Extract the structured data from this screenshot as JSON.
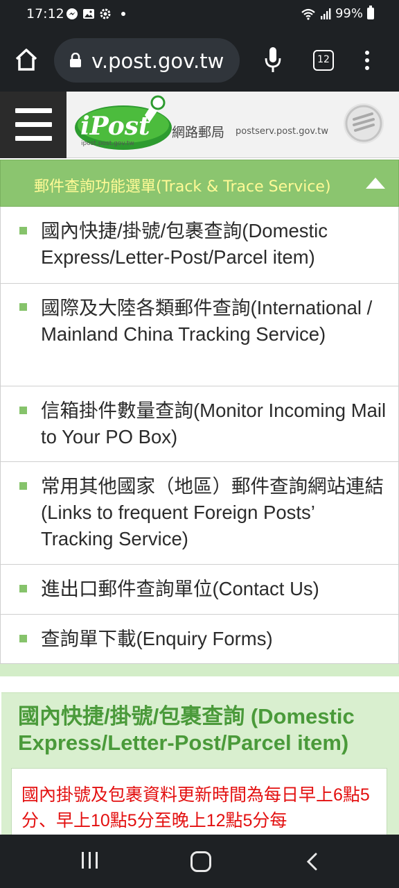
{
  "status_bar": {
    "time": "17:12",
    "battery": "99%"
  },
  "browser": {
    "url": "v.post.gov.tw",
    "tab_count": "12"
  },
  "site_header": {
    "logo_text": "iPost",
    "logo_subtext": "ipost.post.gov.tw",
    "site_name": "網路郵局",
    "site_domain": "postserv.post.gov.tw"
  },
  "accordion": {
    "title": "郵件查詢功能選單(Track & Trace Service)",
    "items": [
      {
        "label": "國內快捷/掛號/包裹查詢(Domestic Express/Letter-Post/Parcel item)"
      },
      {
        "label": "國際及大陸各類郵件查詢(International / Mainland China Tracking Service)"
      },
      {
        "label": "信箱掛件數量查詢(Monitor Incoming Mail to Your PO Box)"
      },
      {
        "label": "常用其他國家（地區）郵件查詢網站連結(Links to frequent Foreign Posts’ Tracking Service)"
      },
      {
        "label": "進出口郵件查詢單位(Contact Us)"
      },
      {
        "label": "查詢單下載(Enquiry Forms)"
      }
    ]
  },
  "content": {
    "title": "國內快捷/掛號/包裹查詢 (Domestic Express/Letter-Post/Parcel item)",
    "notice": "國內掛號及包裹資料更新時間為每日早上6點5分、早上10點5分至晚上12點5分每"
  },
  "colors": {
    "accordion_bg": "#8bc56f",
    "accordion_text": "#fffa96",
    "bullet": "#86c36b",
    "content_title": "#4a9a3a",
    "notice_text": "#e30f0f"
  }
}
